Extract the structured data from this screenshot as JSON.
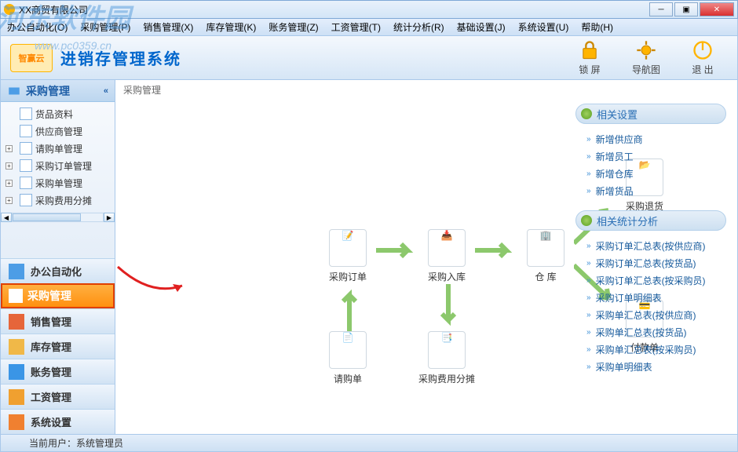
{
  "window": {
    "title": "XX商贸有限公司"
  },
  "watermark": {
    "text": "河东软件园",
    "url": "www.pc0359.cn"
  },
  "menu": [
    "办公自动化(O)",
    "采购管理(P)",
    "销售管理(X)",
    "库存管理(K)",
    "账务管理(Z)",
    "工资管理(T)",
    "统计分析(R)",
    "基础设置(J)",
    "系统设置(U)",
    "帮助(H)"
  ],
  "brand": {
    "logo_text": "智赢云",
    "title": "进销存管理系统"
  },
  "toolbar": {
    "lock": "锁 屏",
    "nav": "导航图",
    "exit": "退 出"
  },
  "sidebar": {
    "header": "采购管理",
    "tree": [
      {
        "label": "货品资料",
        "exp": false
      },
      {
        "label": "供应商管理",
        "exp": false
      },
      {
        "label": "请购单管理",
        "exp": true
      },
      {
        "label": "采购订单管理",
        "exp": true
      },
      {
        "label": "采购单管理",
        "exp": true
      },
      {
        "label": "采购费用分摊",
        "exp": true
      }
    ],
    "accordion": [
      "办公自动化",
      "采购管理",
      "销售管理",
      "库存管理",
      "账务管理",
      "工资管理",
      "系统设置"
    ],
    "active_index": 1
  },
  "crumb": "采购管理",
  "flow": {
    "n1": "采购订单",
    "n2": "采购入库",
    "n3": "仓 库",
    "n4": "采购退货",
    "n5": "付款单",
    "n6": "请购单",
    "n7": "采购费用分摊"
  },
  "rpanel": {
    "h1": "相关设置",
    "links1": [
      "新增供应商",
      "新增员工",
      "新增仓库",
      "新增货品"
    ],
    "h2": "相关统计分析",
    "links2": [
      "采购订单汇总表(按供应商)",
      "采购订单汇总表(按货品)",
      "采购订单汇总表(按采购员)",
      "采购订单明细表",
      "采购单汇总表(按供应商)",
      "采购单汇总表(按货品)",
      "采购单汇总表(按采购员)",
      "采购单明细表"
    ]
  },
  "status": {
    "label": "当前用户：",
    "user": "系统管理员"
  }
}
